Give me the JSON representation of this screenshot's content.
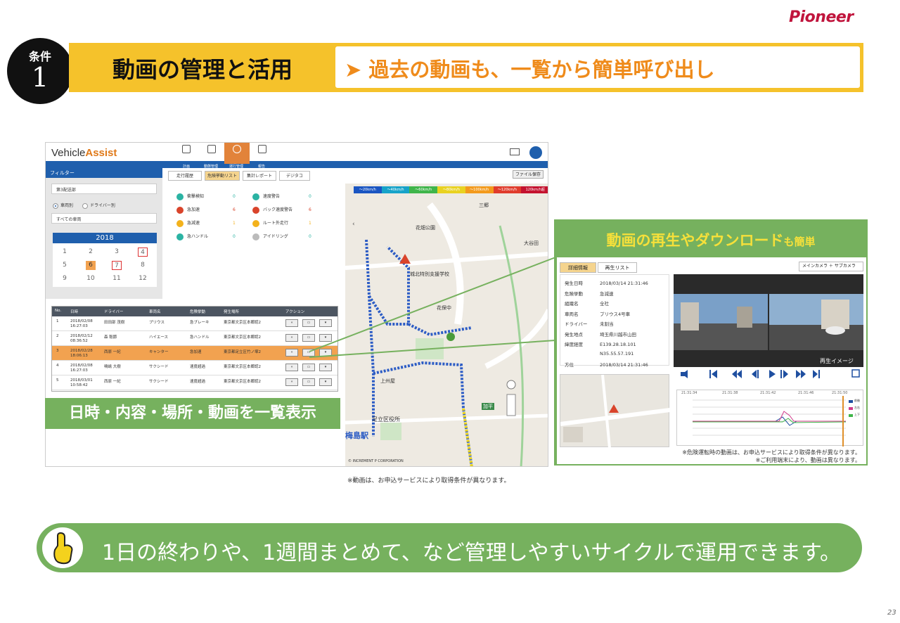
{
  "brand": "Pioneer",
  "badge": {
    "label": "条件",
    "number": "1"
  },
  "section_title": "動画の管理と活用",
  "headline": "➤ 過去の動画も、一覧から簡単呼び出し",
  "app": {
    "logo_main": "Vehicle",
    "logo_accent": "Assist",
    "nav": [
      {
        "label": "計画"
      },
      {
        "label": "動態管理"
      },
      {
        "label": "運行管理"
      },
      {
        "label": "報告"
      }
    ],
    "filter_header": "フィルター",
    "dept_select": "第3配送部",
    "radio_vehicle": "車両別",
    "radio_driver": "ドライバー別",
    "vehicle_select": "すべての車両",
    "calendar_year": "2018",
    "calendar_months": [
      "1",
      "2",
      "3",
      "4",
      "5",
      "6",
      "7",
      "8",
      "9",
      "10",
      "11",
      "12"
    ],
    "tabs": [
      "走行履歴",
      "危険挙動リスト",
      "集計レポート",
      "デジタコ"
    ],
    "file_button": "ファイル保存",
    "events_left": [
      {
        "label": "衝撃検知",
        "count": "0",
        "color": "#2bb3a3"
      },
      {
        "label": "急加速",
        "count": "6",
        "color": "#d9442b"
      },
      {
        "label": "急減速",
        "count": "1",
        "color": "#f3b21c"
      },
      {
        "label": "急ハンドル",
        "count": "0",
        "color": "#2bb3a3"
      }
    ],
    "events_right": [
      {
        "label": "速度警告",
        "count": "0",
        "color": "#2bb3a3"
      },
      {
        "label": "バック速度警告",
        "count": "6",
        "color": "#d9442b"
      },
      {
        "label": "ルート外走行",
        "count": "1",
        "color": "#f3b21c"
      },
      {
        "label": "アイドリング",
        "count": "0",
        "color": "#bbbbbb"
      }
    ],
    "speed_legend": [
      {
        "label": "～20km/h",
        "color": "#1a55c2"
      },
      {
        "label": "～40km/h",
        "color": "#17a3c9"
      },
      {
        "label": "～60km/h",
        "color": "#3fb54a"
      },
      {
        "label": "～80km/h",
        "color": "#e9d220"
      },
      {
        "label": "～100km/h",
        "color": "#f39a1c"
      },
      {
        "label": "～120km/h",
        "color": "#e03c2c"
      },
      {
        "label": "120km/h超",
        "color": "#c4122f"
      }
    ],
    "map_labels": [
      "花畑公園",
      "城北特別支援学校",
      "花保中",
      "上州屋",
      "足立区役所",
      "梅島駅",
      "加平",
      "大谷田",
      "三郷"
    ],
    "map_copyright": "© INCREMENT P CORPORATION",
    "table_headers": [
      "No.",
      "日時",
      "ドライバー",
      "車両名",
      "危険挙動",
      "発生場所",
      "アクション"
    ],
    "table_rows": [
      {
        "no": "1",
        "date": "2018/02/08",
        "time": "16:27:03",
        "driver": "田田部 茂樹",
        "vehicle": "プリウス",
        "event": "急ブレーキ",
        "place": "東京都文京区本郷認2"
      },
      {
        "no": "2",
        "date": "2018/02/12",
        "time": "08:36:52",
        "driver": "森 聡節",
        "vehicle": "ハイエース",
        "event": "急ハンドル",
        "place": "東京都文京区本郷認2"
      },
      {
        "no": "3",
        "date": "2018/02/28",
        "time": "18:06:13",
        "driver": "西原 一紀",
        "vehicle": "キャンター",
        "event": "急加速",
        "place": "東京都足立区竹ノ塚2"
      },
      {
        "no": "4",
        "date": "2018/02/08",
        "time": "16:27:03",
        "driver": "鳴嶋 大樹",
        "vehicle": "サクシード",
        "event": "速度超過",
        "place": "東京都文京区本郷認2"
      },
      {
        "no": "5",
        "date": "2018/03/01",
        "time": "10:58:42",
        "driver": "西原 一紀",
        "vehicle": "サクシード",
        "event": "速度超過",
        "place": "東京都文京区本郷認2"
      }
    ]
  },
  "list_caption": "日時・内容・場所・動画を一覧表示",
  "detail": {
    "title_main": "動画の再生やダウンロード",
    "title_small": "も簡単",
    "tab_info": "詳細情報",
    "tab_playlist": "再生リスト",
    "camera_select": "メインカメラ ＋ サブカメラ",
    "rows": [
      {
        "k": "発生日時",
        "v": "2018/03/14 21:31:46"
      },
      {
        "k": "危険挙動",
        "v": "急減速"
      },
      {
        "k": "組織名",
        "v": "全社"
      },
      {
        "k": "車両名",
        "v": "プリウス4号車"
      },
      {
        "k": "ドライバー",
        "v": "未割当"
      },
      {
        "k": "発生地点",
        "v": "埼玉県川越市山田"
      },
      {
        "k": "緯度経度",
        "v": "E139.28.18.101"
      },
      {
        "k": "",
        "v": "N35.55.57.191"
      },
      {
        "k": "方位",
        "v": "2018/03/14 21:31:46"
      }
    ],
    "video_caption": "再生イメージ",
    "graph_times": [
      "21:31:34",
      "21:31:38",
      "21:31:42",
      "21:31:46",
      "21:31:50"
    ],
    "graph_legend": [
      "前後",
      "左右",
      "上下"
    ],
    "note": "※危険運転時の動画は、お申込サービスにより取得条件が異なります。\n※ご利用端末により、動画は異なります。"
  },
  "footnote": "※動画は、お申込サービスにより取得条件が異なります。",
  "bottom_message": "1日の終わりや、1週間まとめて、など管理しやすいサイクルで運用できます。",
  "page_number": "23"
}
